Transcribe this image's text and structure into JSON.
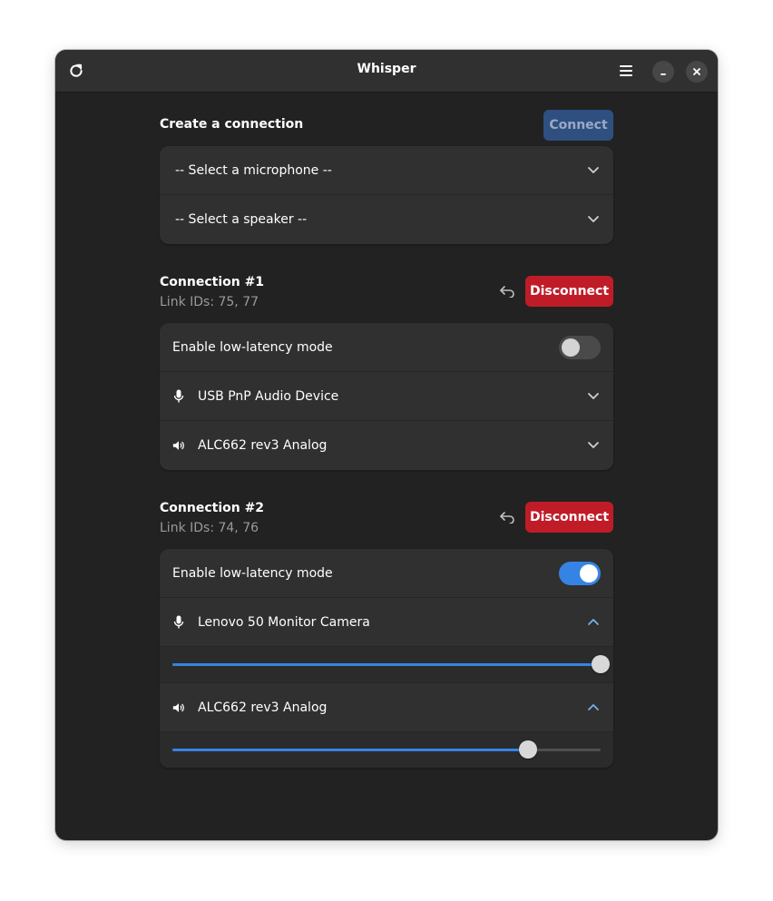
{
  "window": {
    "title": "Whisper"
  },
  "header": {
    "refresh_icon": "refresh-icon",
    "menu_icon": "hamburger-menu-icon",
    "minimize_icon": "minimize-icon",
    "close_icon": "close-icon"
  },
  "create": {
    "title": "Create a connection",
    "connect_label": "Connect",
    "microphone_placeholder": "-- Select a microphone --",
    "speaker_placeholder": "-- Select a speaker --"
  },
  "connections": [
    {
      "title": "Connection #1",
      "link_ids": "Link IDs: 75, 77",
      "disconnect_label": "Disconnect",
      "low_latency_label": "Enable low-latency mode",
      "low_latency_enabled": false,
      "microphone": "USB PnP Audio Device",
      "speaker": "ALC662 rev3 Analog",
      "expanded": false
    },
    {
      "title": "Connection #2",
      "link_ids": "Link IDs: 74, 76",
      "disconnect_label": "Disconnect",
      "low_latency_label": "Enable low-latency mode",
      "low_latency_enabled": true,
      "microphone": "Lenovo 50 Monitor Camera",
      "microphone_volume": 1.0,
      "speaker": "ALC662 rev3 Analog",
      "speaker_volume": 0.83,
      "expanded": true
    }
  ],
  "colors": {
    "accent": "#3584e4",
    "destructive": "#c01c28",
    "window_bg": "#222222",
    "card_bg": "#303030"
  }
}
